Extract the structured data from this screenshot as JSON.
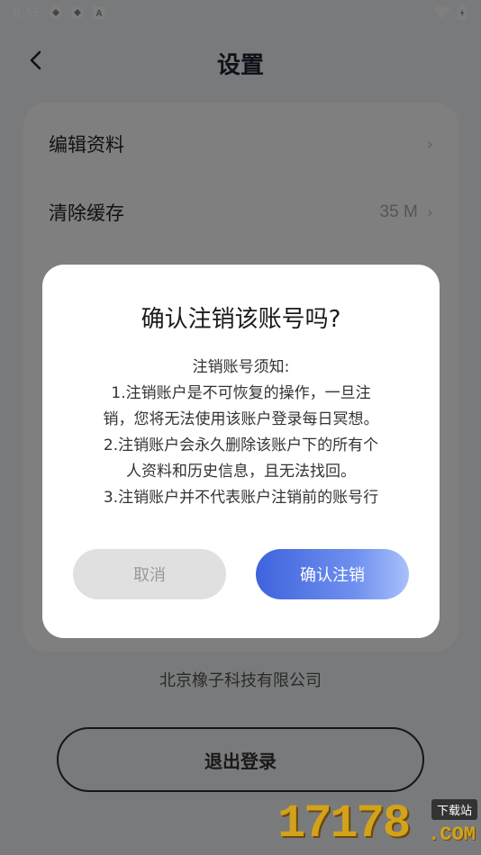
{
  "status_bar": {
    "time": "8:55",
    "notification_icons": [
      "notification-icon",
      "notification-icon",
      "text-app-icon"
    ],
    "text_app_glyph": "A"
  },
  "header": {
    "title": "设置"
  },
  "settings": {
    "items": [
      {
        "label": "编辑资料",
        "value": ""
      },
      {
        "label": "清除缓存",
        "value": "35 M"
      }
    ]
  },
  "footer": {
    "company": "北京橡子科技有限公司",
    "logout_label": "退出登录"
  },
  "dialog": {
    "title": "确认注销该账号吗?",
    "notice_heading": "注销账号须知:",
    "notice_lines": [
      "1.注销账户是不可恢复的操作，一旦注",
      "销，您将无法使用该账户登录每日冥想。",
      "2.注销账户会永久删除该账户下的所有个",
      "人资料和历史信息，且无法找回。",
      "3.注销账户并不代表账户注销前的账号行"
    ],
    "cancel_label": "取消",
    "confirm_label": "确认注销"
  },
  "watermark": {
    "digits": "17178",
    "tag": "下载站",
    "domain": ".COM"
  },
  "colors": {
    "confirm_gradient_start": "#3f63dd",
    "confirm_gradient_end": "#a9c0fb",
    "cancel_bg": "#e0e0e0",
    "overlay": "rgba(0,0,0,0.5)"
  }
}
